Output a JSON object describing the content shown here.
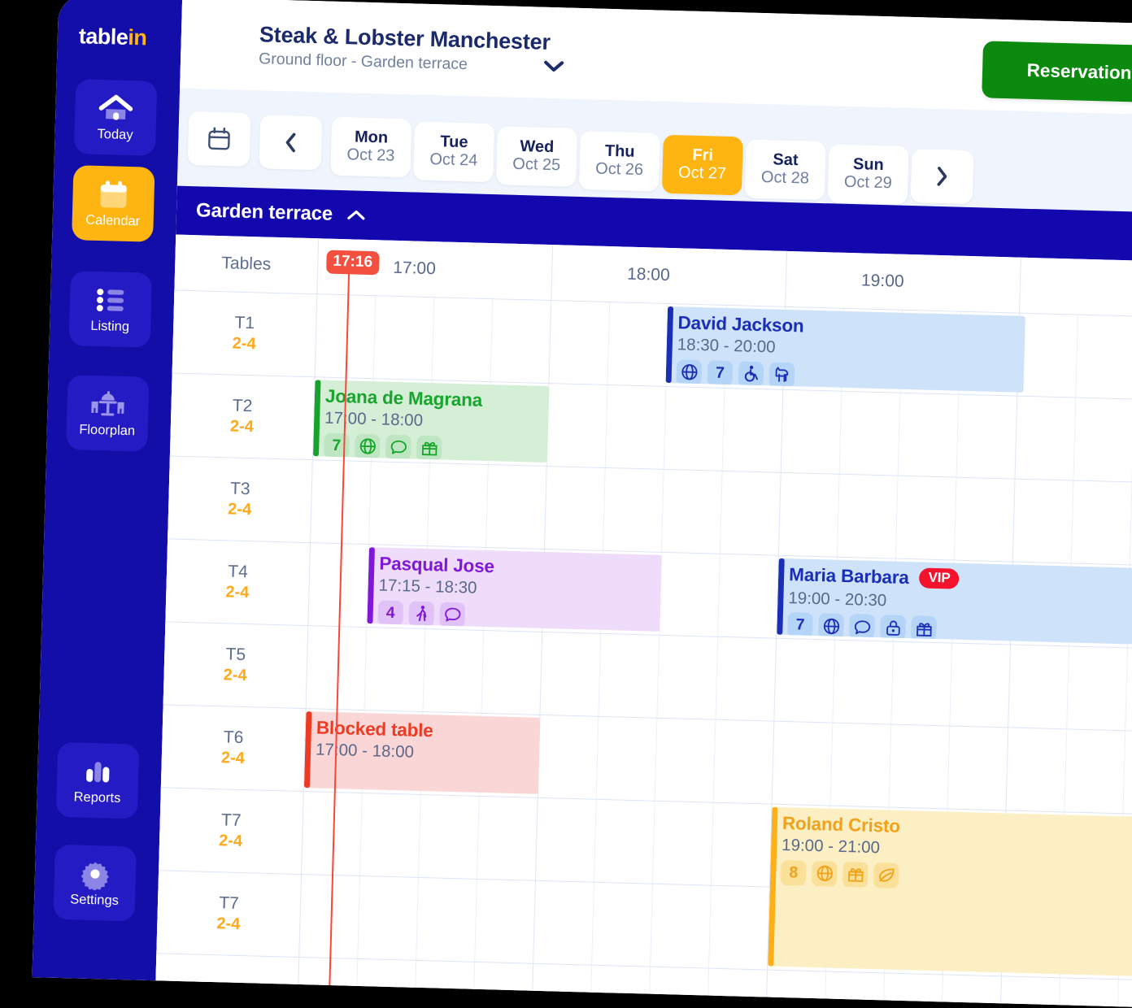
{
  "brand": {
    "name_white": "table",
    "name_orange": "in",
    "orange": "#FFB511",
    "navy": "#140EA8"
  },
  "sidebar": {
    "items": [
      {
        "label": "Today",
        "icon": "home-icon",
        "active": false
      },
      {
        "label": "Calendar",
        "icon": "calendar-icon",
        "active": true
      },
      {
        "label": "Listing",
        "icon": "list-icon",
        "active": false
      },
      {
        "label": "Floorplan",
        "icon": "floorplan-icon",
        "active": false
      }
    ],
    "bottom_items": [
      {
        "label": "Reports",
        "icon": "bar-chart-icon"
      },
      {
        "label": "Settings",
        "icon": "gear-icon"
      }
    ]
  },
  "header": {
    "title": "Steak & Lobster Manchester",
    "subtitle": "Ground floor - Garden terrace",
    "venue_chevron": "chevron-down-icon",
    "reservation_button": "Reservation",
    "reservation_color": "#0B8A0E"
  },
  "datebar": {
    "calendar_icon": "calendar-icon",
    "prev_icon": "chevron-left-icon",
    "next_icon": "chevron-right-icon",
    "days": [
      {
        "dow": "Mon",
        "date": "Oct 23",
        "selected": false
      },
      {
        "dow": "Tue",
        "date": "Oct 24",
        "selected": false
      },
      {
        "dow": "Wed",
        "date": "Oct 25",
        "selected": false
      },
      {
        "dow": "Thu",
        "date": "Oct 26",
        "selected": false
      },
      {
        "dow": "Fri",
        "date": "Oct 27",
        "selected": true
      },
      {
        "dow": "Sat",
        "date": "Oct 28",
        "selected": false
      },
      {
        "dow": "Sun",
        "date": "Oct 29",
        "selected": false
      }
    ]
  },
  "section": {
    "name": "Garden terrace",
    "collapse_icon": "chevron-up-icon"
  },
  "grid": {
    "tables_header": "Tables",
    "time_labels": [
      "17:00",
      "18:00",
      "19:00"
    ],
    "current_time": "17:16",
    "rows": [
      {
        "name": "T1",
        "capacity": "2-4"
      },
      {
        "name": "T2",
        "capacity": "2-4"
      },
      {
        "name": "T3",
        "capacity": "2-4"
      },
      {
        "name": "T4",
        "capacity": "2-4"
      },
      {
        "name": "T5",
        "capacity": "2-4"
      },
      {
        "name": "T6",
        "capacity": "2-4"
      },
      {
        "name": "T7",
        "capacity": "2-4"
      },
      {
        "name": "T7",
        "capacity": "2-4"
      }
    ]
  },
  "reservations": [
    {
      "name": "David Jackson",
      "time": "18:30 - 20:00",
      "row": 0,
      "color": "blue",
      "guests": "7",
      "vip": false,
      "icons": [
        "globe-icon",
        "guests-count",
        "wheelchair-icon",
        "dog-icon"
      ]
    },
    {
      "name": "Joana de Magrana",
      "time": "17:00 - 18:00",
      "row": 1,
      "color": "green",
      "guests": "7",
      "vip": false,
      "icons": [
        "guests-count",
        "globe-icon",
        "chat-icon",
        "gift-icon"
      ]
    },
    {
      "name": "Pasqual Jose",
      "time": "17:15 - 18:30",
      "row": 3,
      "color": "purple",
      "guests": "4",
      "vip": false,
      "icons": [
        "guests-count",
        "walk-icon",
        "chat-icon"
      ]
    },
    {
      "name": "Maria Barbara",
      "time": "19:00 - 20:30",
      "row": 3,
      "color": "blue",
      "guests": "7",
      "vip": true,
      "vip_label": "VIP",
      "icons": [
        "guests-count",
        "globe-icon",
        "chat-icon",
        "lock-icon",
        "gift-icon"
      ]
    },
    {
      "name": "Blocked table",
      "time": "17:00 - 18:00",
      "row": 5,
      "color": "red",
      "guests": "",
      "vip": false,
      "icons": []
    },
    {
      "name": "Roland Cristo",
      "time": "19:00 - 21:00",
      "row": 6,
      "color": "amber",
      "guests": "8",
      "vip": false,
      "icons": [
        "guests-count",
        "globe-icon",
        "gift-icon",
        "leaf-icon"
      ]
    }
  ]
}
